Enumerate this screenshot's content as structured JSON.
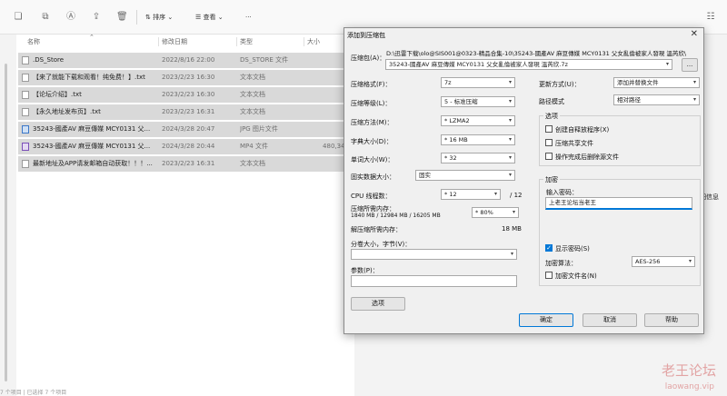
{
  "toolbar": {
    "sort_label": "排序",
    "view_label": "查看",
    "more_label": "···",
    "details_label": "详细信息"
  },
  "columns": {
    "name": "名称",
    "modified": "修改日期",
    "type": "类型",
    "size": "大小"
  },
  "files": [
    {
      "name": ".DS_Store",
      "modified": "2022/8/16 22:00",
      "type": "DS_STORE 文件",
      "size": "",
      "icon": "file-icon"
    },
    {
      "name": "【来了就能下载和观看！纯免费！】.txt",
      "modified": "2023/2/23 16:30",
      "type": "文本文档",
      "size": "",
      "icon": "text-file-icon"
    },
    {
      "name": "【论坛介绍】.txt",
      "modified": "2023/2/23 16:30",
      "type": "文本文档",
      "size": "",
      "icon": "text-file-icon"
    },
    {
      "name": "【永久地址发布页】.txt",
      "modified": "2023/2/23 16:31",
      "type": "文本文档",
      "size": "",
      "icon": "text-file-icon"
    },
    {
      "name": "35243-國產AV 麻豆傳媒 MCY0131 父...",
      "modified": "2024/3/28 20:47",
      "type": "JPG 图片文件",
      "size": "",
      "icon": "image-file-icon"
    },
    {
      "name": "35243-國產AV 麻豆傳媒 MCY0131 父...",
      "modified": "2024/3/28 20:44",
      "type": "MP4 文件",
      "size": "480,342",
      "icon": "video-file-icon"
    },
    {
      "name": "最新地址及APP请发邮箱自动获取！！！...",
      "modified": "2023/2/23 16:31",
      "type": "文本文档",
      "size": "",
      "icon": "text-file-icon"
    }
  ],
  "right_pane_text": "细信息",
  "status_text": "7 个项目 | 已选择 7 个项目",
  "dialog": {
    "title": "添加到压缩包",
    "close": "✕",
    "archive_label": "压缩包(A)：",
    "archive_path": "D:\\迅雷下载\\olo@SIS001@0323-精品合集-10\\35243-國產AV 麻豆傳媒 MCY0131 父女亂倫被家人發現 溫芮欣\\",
    "archive_name": "35243-國產AV 麻豆傳媒 MCY0131 父女亂倫被家人發現 溫芮欣.7z",
    "browse": "...",
    "format_label": "压缩格式(F)：",
    "format_value": "7z",
    "level_label": "压缩等级(L)：",
    "level_value": "5 - 标准压缩",
    "method_label": "压缩方法(M)：",
    "method_value": "* LZMA2",
    "dict_label": "字典大小(D)：",
    "dict_value": "* 16 MB",
    "word_label": "单词大小(W)：",
    "word_value": "* 32",
    "solid_label": "固实数据大小：",
    "solid_value": "固实",
    "threads_label": "CPU 线程数：",
    "threads_value": "* 12",
    "threads_total": "/ 12",
    "mem_label": "压缩所需内存：",
    "mem_detail": "1840 MB / 12984 MB / 16205 MB",
    "mem_value": "* 80%",
    "demem_label": "解压缩所需内存：",
    "demem_value": "18 MB",
    "split_label": "分卷大小，字节(V)：",
    "split_value": "",
    "params_label": "参数(P)：",
    "params_value": "",
    "options_button": "选项",
    "update_label": "更新方式(U)：",
    "update_value": "添加并替换文件",
    "pathmode_label": "路径模式",
    "pathmode_value": "相对路径",
    "options_group": "选项",
    "opt_sfx": "创建自释放程序(X)",
    "opt_shared": "压缩共享文件",
    "opt_delete": "操作完成后删除源文件",
    "encrypt_group": "加密",
    "password_label": "输入密码：",
    "password_value": "上老王论坛当老王",
    "show_password": "显示密码(S)",
    "enc_method_label": "加密算法：",
    "enc_method_value": "AES-256",
    "encrypt_names": "加密文件名(N)",
    "ok": "确定",
    "cancel": "取消",
    "help": "帮助"
  },
  "watermark": {
    "main": "老王论坛",
    "sub": "laowang.vip"
  }
}
